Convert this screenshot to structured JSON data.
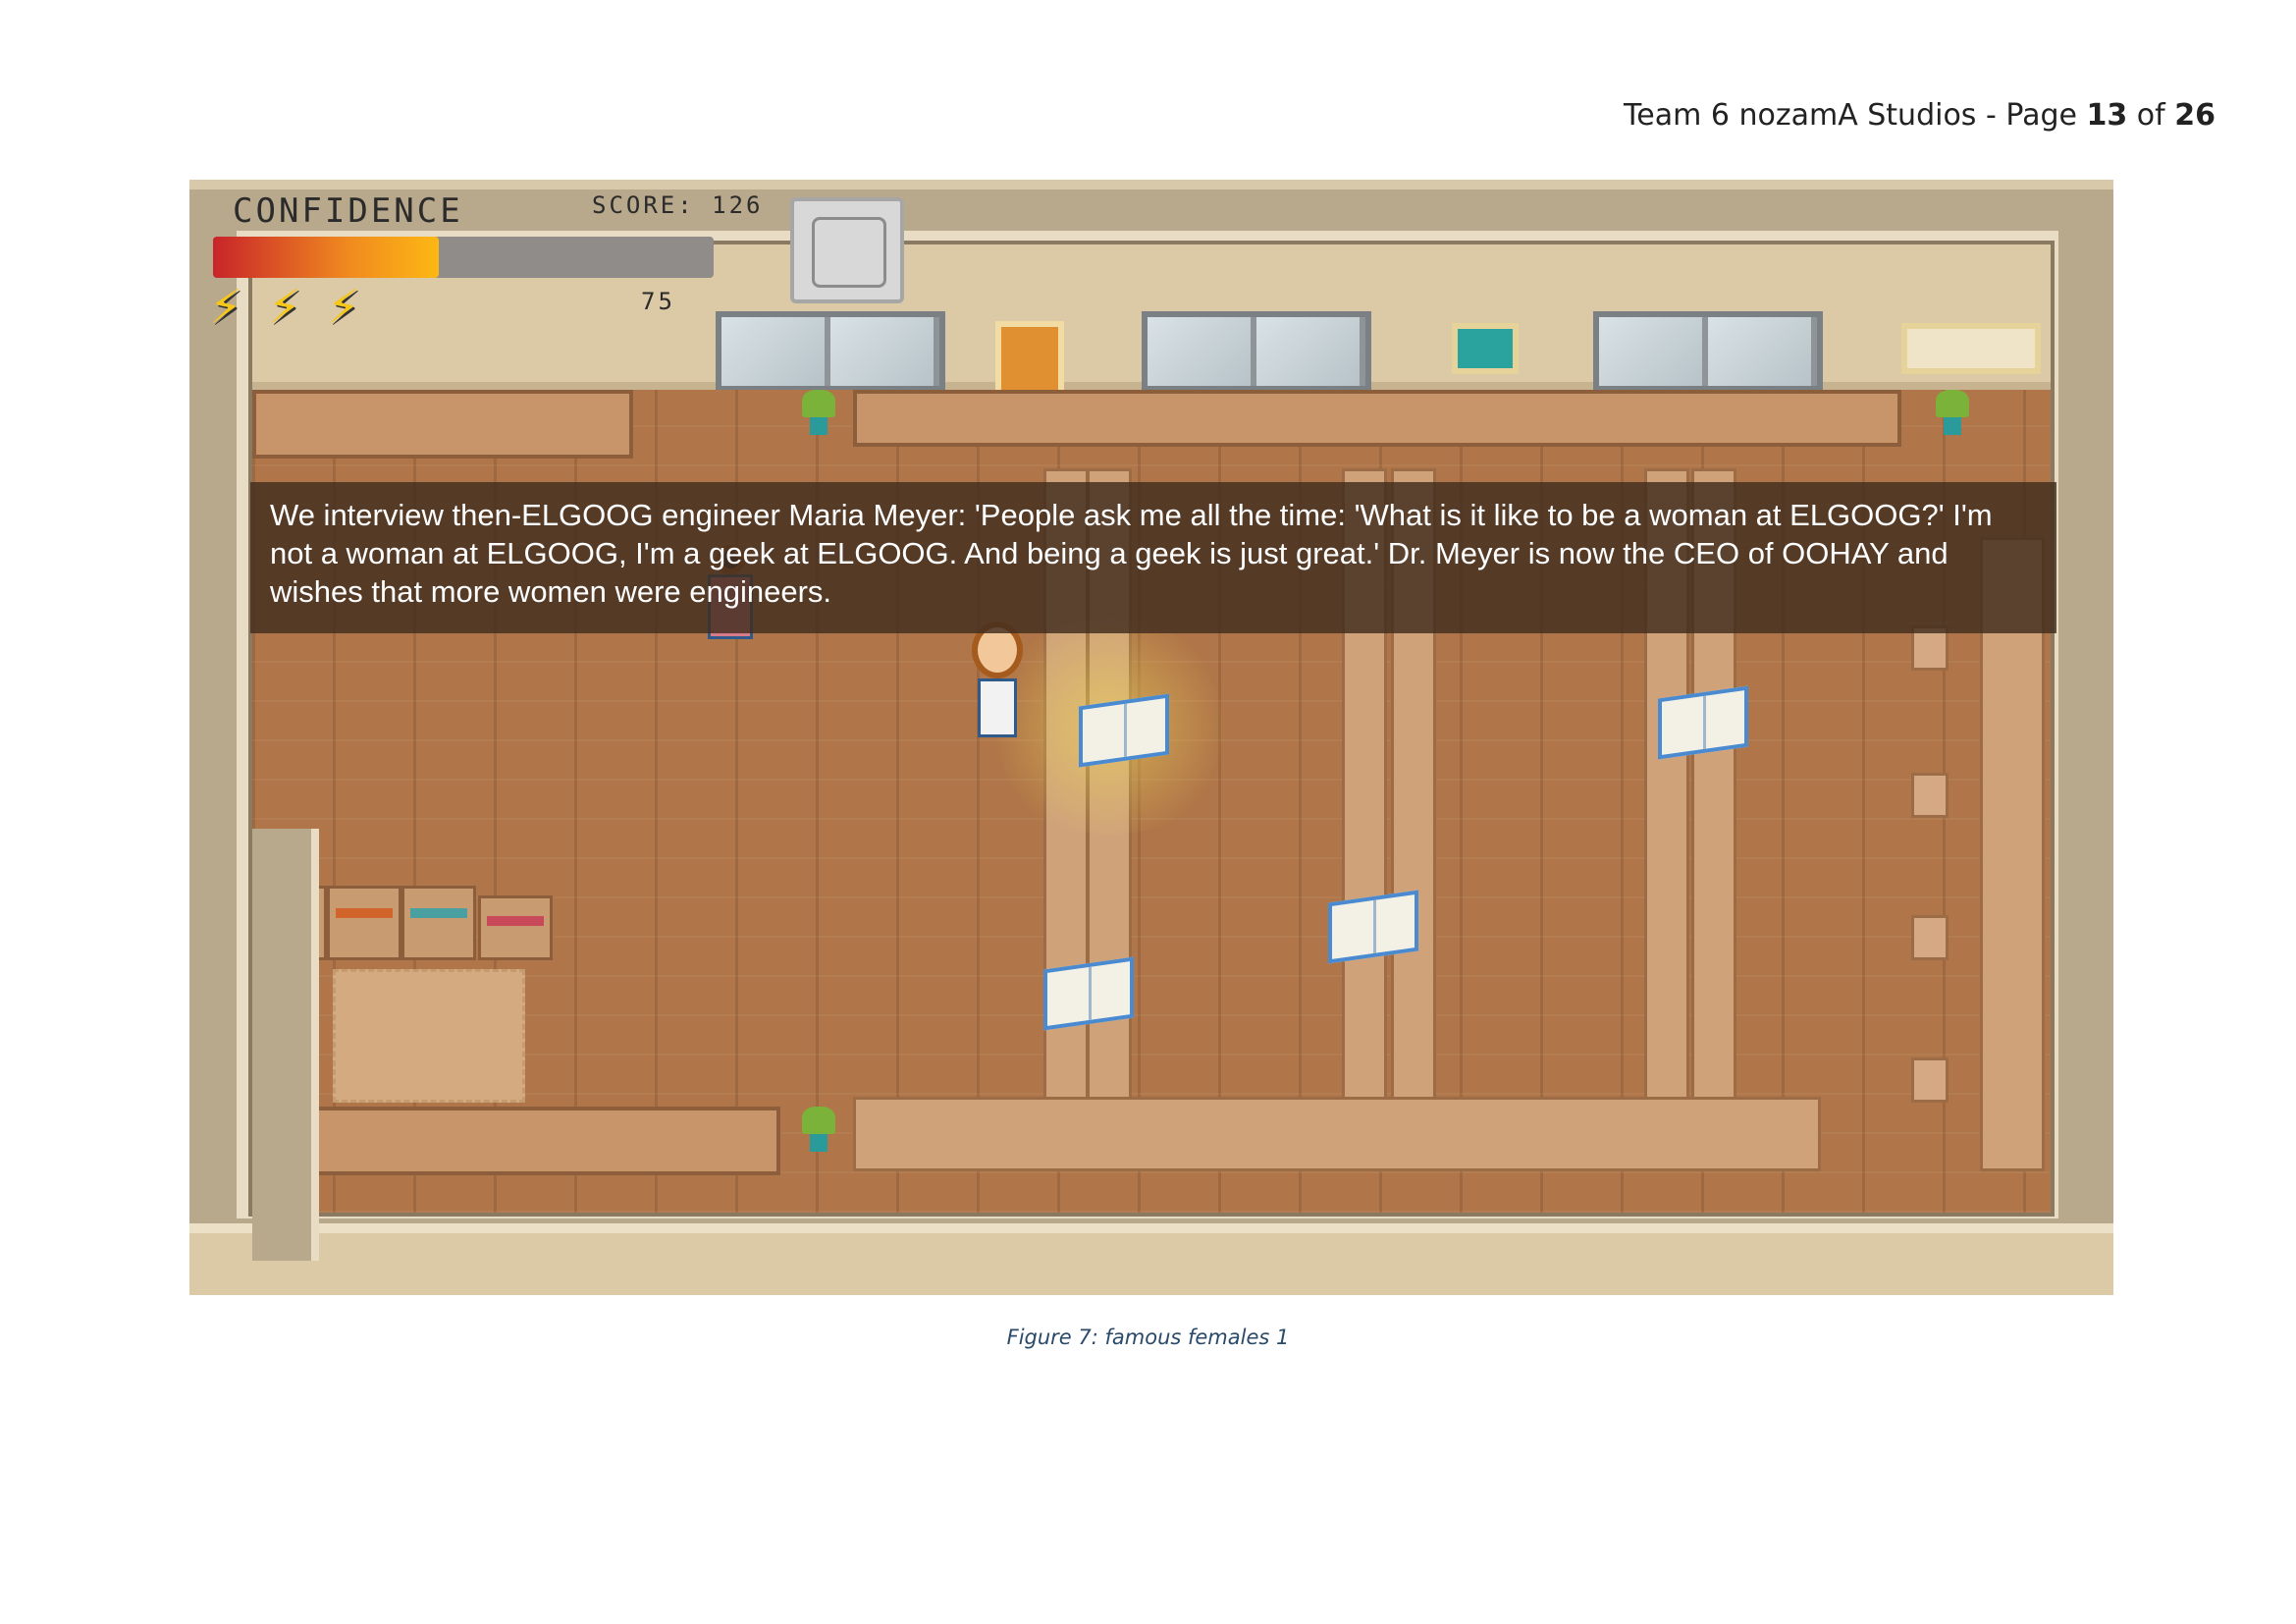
{
  "page_header": {
    "prefix": "Team 6 nozamA Studios - Page ",
    "page": "13",
    "of": " of ",
    "total": "26"
  },
  "hud": {
    "confidence_label": "CONFIDENCE",
    "score_label": "SCORE: 126",
    "confidence_level_percent": 45,
    "lives_count": "75",
    "energy_bolts": 3
  },
  "dialogue": {
    "text": "We interview then-ELGOOG engineer Maria Meyer: 'People ask me all the time: 'What is it like to be a woman at ELGOOG?' I'm not a woman at ELGOOG, I'm a geek at ELGOOG. And being a geek is just great.' Dr. Meyer is now the CEO of OOHAY and wishes that more women were engineers."
  },
  "caption": "Figure 7: famous females 1",
  "icons": [
    "lightning-bolt-icon",
    "pause-icon",
    "book-icon",
    "plant-icon"
  ],
  "colors": {
    "confidence_start": "#c8242a",
    "confidence_end": "#fdb814",
    "dialogue_bg": "#412d1e",
    "floor": "#b07548"
  }
}
